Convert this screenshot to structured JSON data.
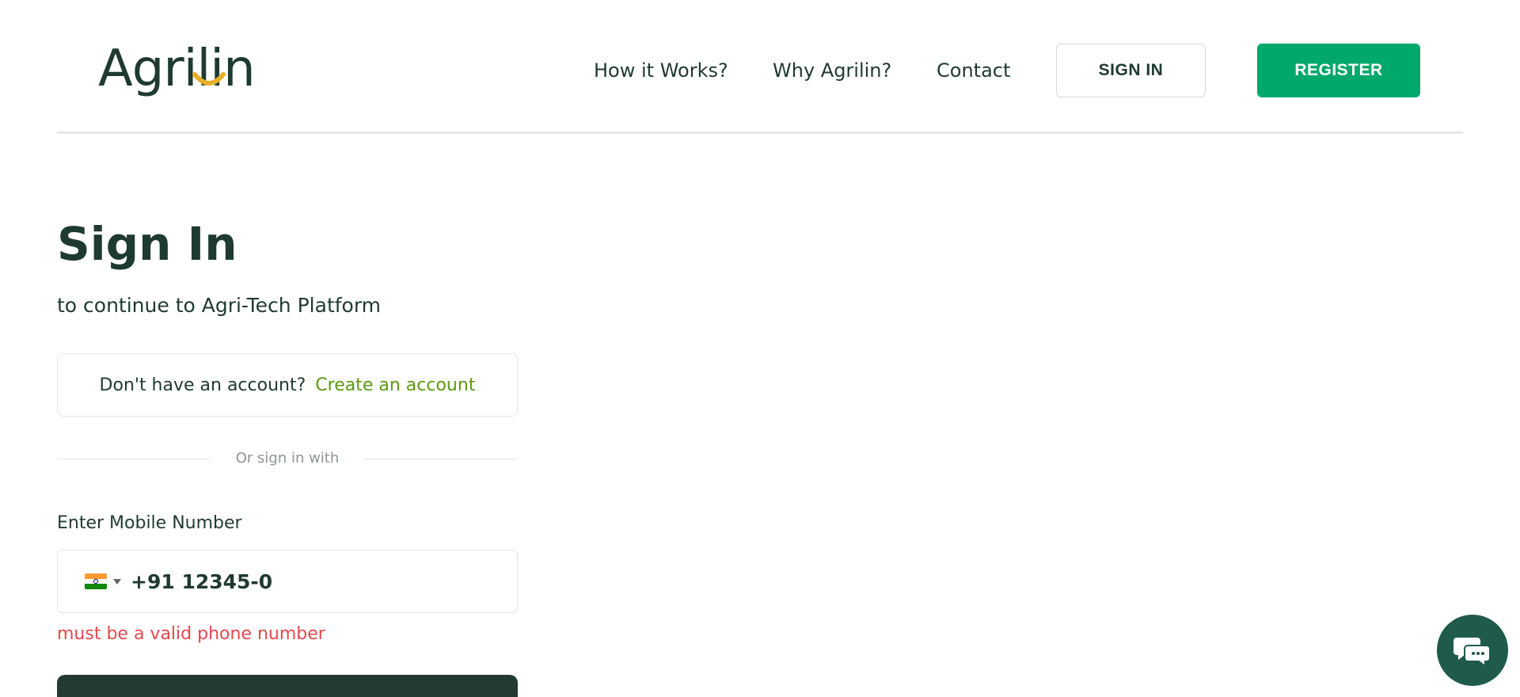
{
  "brand": {
    "name": "Agrilin"
  },
  "nav": {
    "how_it_works": "How it Works?",
    "why": "Why Agrilin?",
    "contact": "Contact",
    "sign_in": "SIGN IN",
    "register": "REGISTER"
  },
  "page": {
    "title": "Sign In",
    "subtitle": "to continue to Agri-Tech Platform"
  },
  "account": {
    "question": "Don't have an account?",
    "link": "Create an account"
  },
  "divider": {
    "text": "Or sign in with"
  },
  "mobile": {
    "label": "Enter Mobile Number",
    "value": "+91 12345-0",
    "country_icon": "india-flag-icon",
    "error": "must be a valid phone number"
  },
  "icons": {
    "chat": "chat-icon",
    "dropdown": "caret-down-icon"
  },
  "colors": {
    "primary_dark": "#1f3a30",
    "accent_green": "#00a86b",
    "link_green": "#5a9a10",
    "error_red": "#e5484d",
    "chat_bg": "#1f5a4a",
    "logo_accent": "#e8b02a"
  }
}
